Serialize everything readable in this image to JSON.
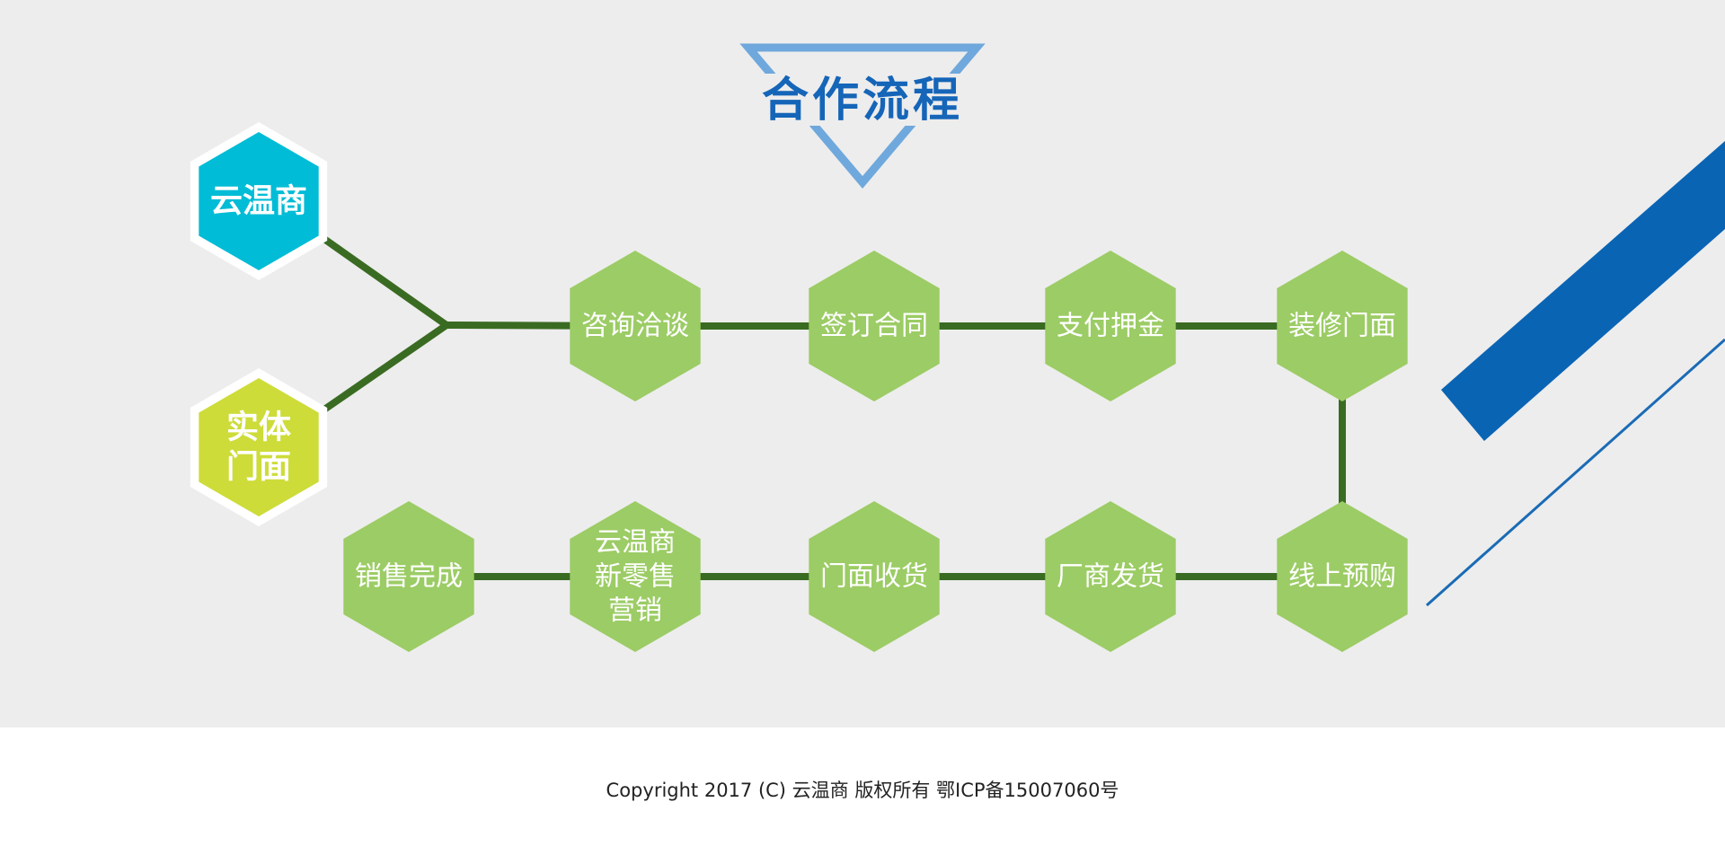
{
  "title": "合作流程",
  "sources": [
    {
      "id": "yunwenshang",
      "lines": [
        "云温商"
      ],
      "color": "#00bcd6"
    },
    {
      "id": "physical-store",
      "lines": [
        "实体",
        "门面"
      ],
      "color": "#cddc39"
    }
  ],
  "steps": [
    {
      "id": "consult",
      "lines": [
        "咨询洽谈"
      ]
    },
    {
      "id": "sign-contract",
      "lines": [
        "签订合同"
      ]
    },
    {
      "id": "pay-deposit",
      "lines": [
        "支付押金"
      ]
    },
    {
      "id": "decorate-store",
      "lines": [
        "装修门面"
      ]
    },
    {
      "id": "online-preorder",
      "lines": [
        "线上预购"
      ]
    },
    {
      "id": "factory-ship",
      "lines": [
        "厂商发货"
      ]
    },
    {
      "id": "store-receive",
      "lines": [
        "门面收货"
      ]
    },
    {
      "id": "new-retail-marketing",
      "lines": [
        "云温商",
        "新零售",
        "营销"
      ]
    },
    {
      "id": "sale-complete",
      "lines": [
        "销售完成"
      ]
    }
  ],
  "colors": {
    "step_fill": "#9ccc65",
    "connector": "#3a6b22",
    "title": "#1565b8",
    "title_triangle": "#6fa8dc",
    "stripe": "#0a64b4",
    "background": "#ededed",
    "footer_background": "#ffffff"
  },
  "footer": {
    "text": "Copyright 2017 (C) 云温商 版权所有 鄂ICP备15007060号"
  }
}
